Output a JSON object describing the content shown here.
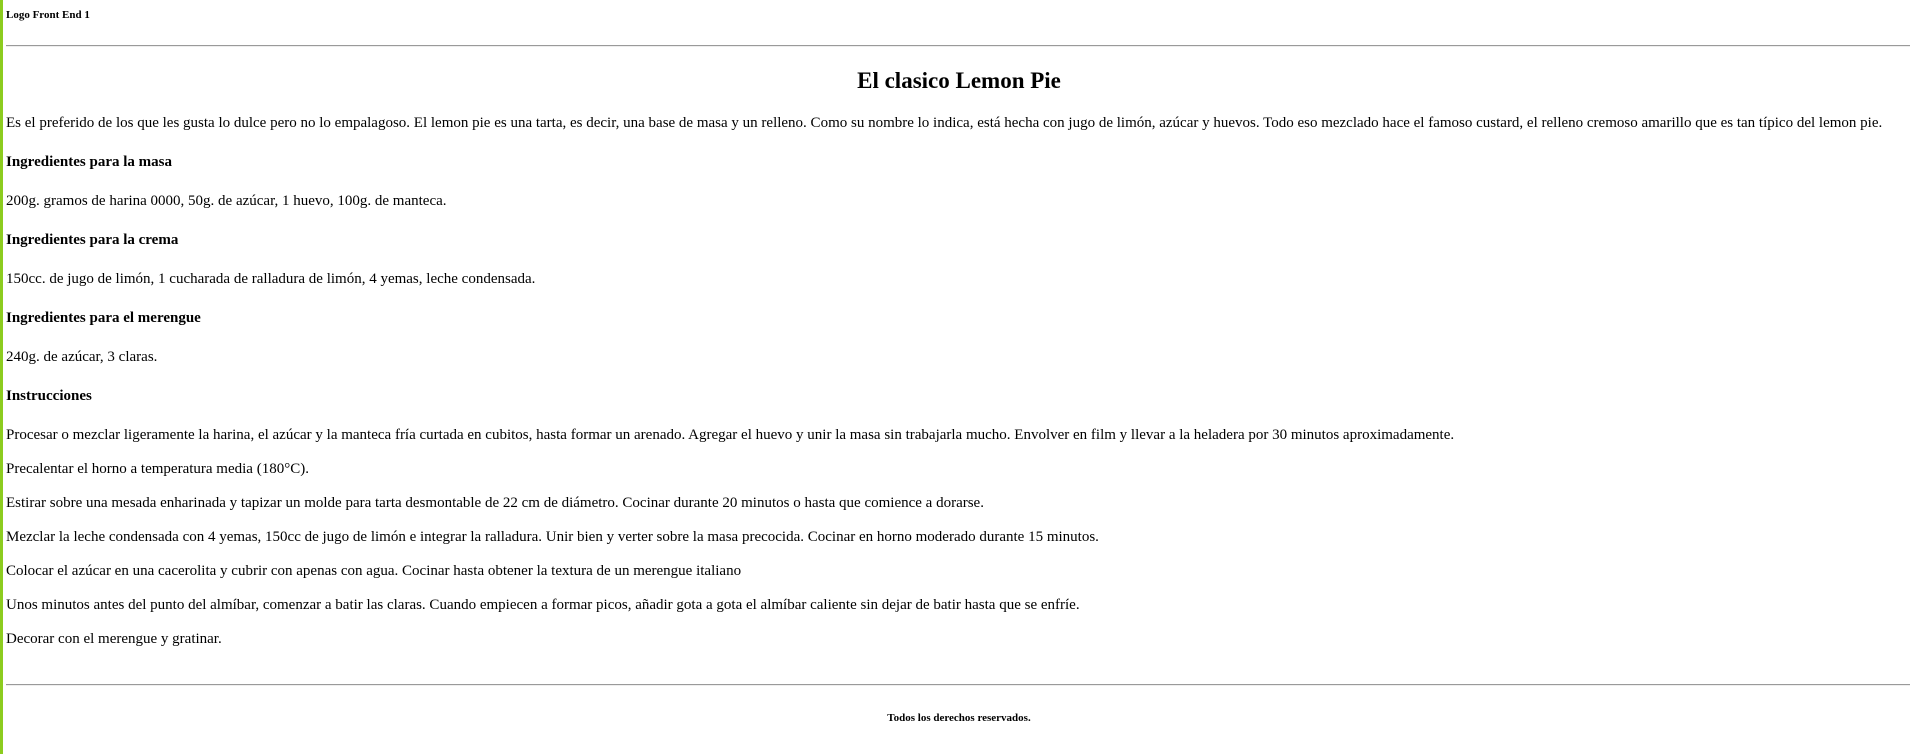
{
  "header": {
    "logo": "Logo Front End 1"
  },
  "main": {
    "title": "El clasico Lemon Pie",
    "intro": "Es el preferido de los que les gusta lo dulce pero no lo empalagoso. El lemon pie es una tarta, es decir, una base de masa y un relleno. Como su nombre lo indica, está hecha con jugo de limón, azúcar y huevos. Todo eso mezclado hace el famoso custard, el relleno cremoso amarillo que es tan típico del lemon pie.",
    "sections": [
      {
        "heading": "Ingredientes para la masa",
        "text": "200g. gramos de harina 0000, 50g. de azúcar, 1 huevo, 100g. de manteca."
      },
      {
        "heading": "Ingredientes para la crema",
        "text": "150cc. de jugo de limón, 1 cucharada de ralladura de limón, 4 yemas, leche condensada."
      },
      {
        "heading": "Ingredientes para el merengue",
        "text": "240g. de azúcar, 3 claras."
      }
    ],
    "instructions_heading": "Instrucciones",
    "steps": [
      "Procesar o mezclar ligeramente la harina, el azúcar y la manteca fría curtada en cubitos, hasta formar un arenado. Agregar el huevo y unir la masa sin trabajarla mucho. Envolver en film y llevar a la heladera por 30 minutos aproximadamente.",
      "Precalentar el horno a temperatura media (180°C).",
      "Estirar sobre una mesada enharinada y tapizar un molde para tarta desmontable de 22 cm de diámetro. Cocinar durante 20 minutos o hasta que comience a dorarse.",
      "Mezclar la leche condensada con 4 yemas, 150cc de jugo de limón e integrar la ralladura. Unir bien y verter sobre la masa precocida. Cocinar en horno moderado durante 15 minutos.",
      "Colocar el azúcar en una cacerolita y cubrir con apenas con agua. Cocinar hasta obtener la textura de un merengue italiano",
      "Unos minutos antes del punto del almíbar, comenzar a batir las claras. Cuando empiecen a formar picos, añadir gota a gota el almíbar caliente sin dejar de batir hasta que se enfríe.",
      "Decorar con el merengue y gratinar."
    ]
  },
  "footer": {
    "text": "Todos los derechos reservados."
  },
  "colors": {
    "left_border": "#8ccc1f",
    "rule": "#9a9a9a"
  }
}
